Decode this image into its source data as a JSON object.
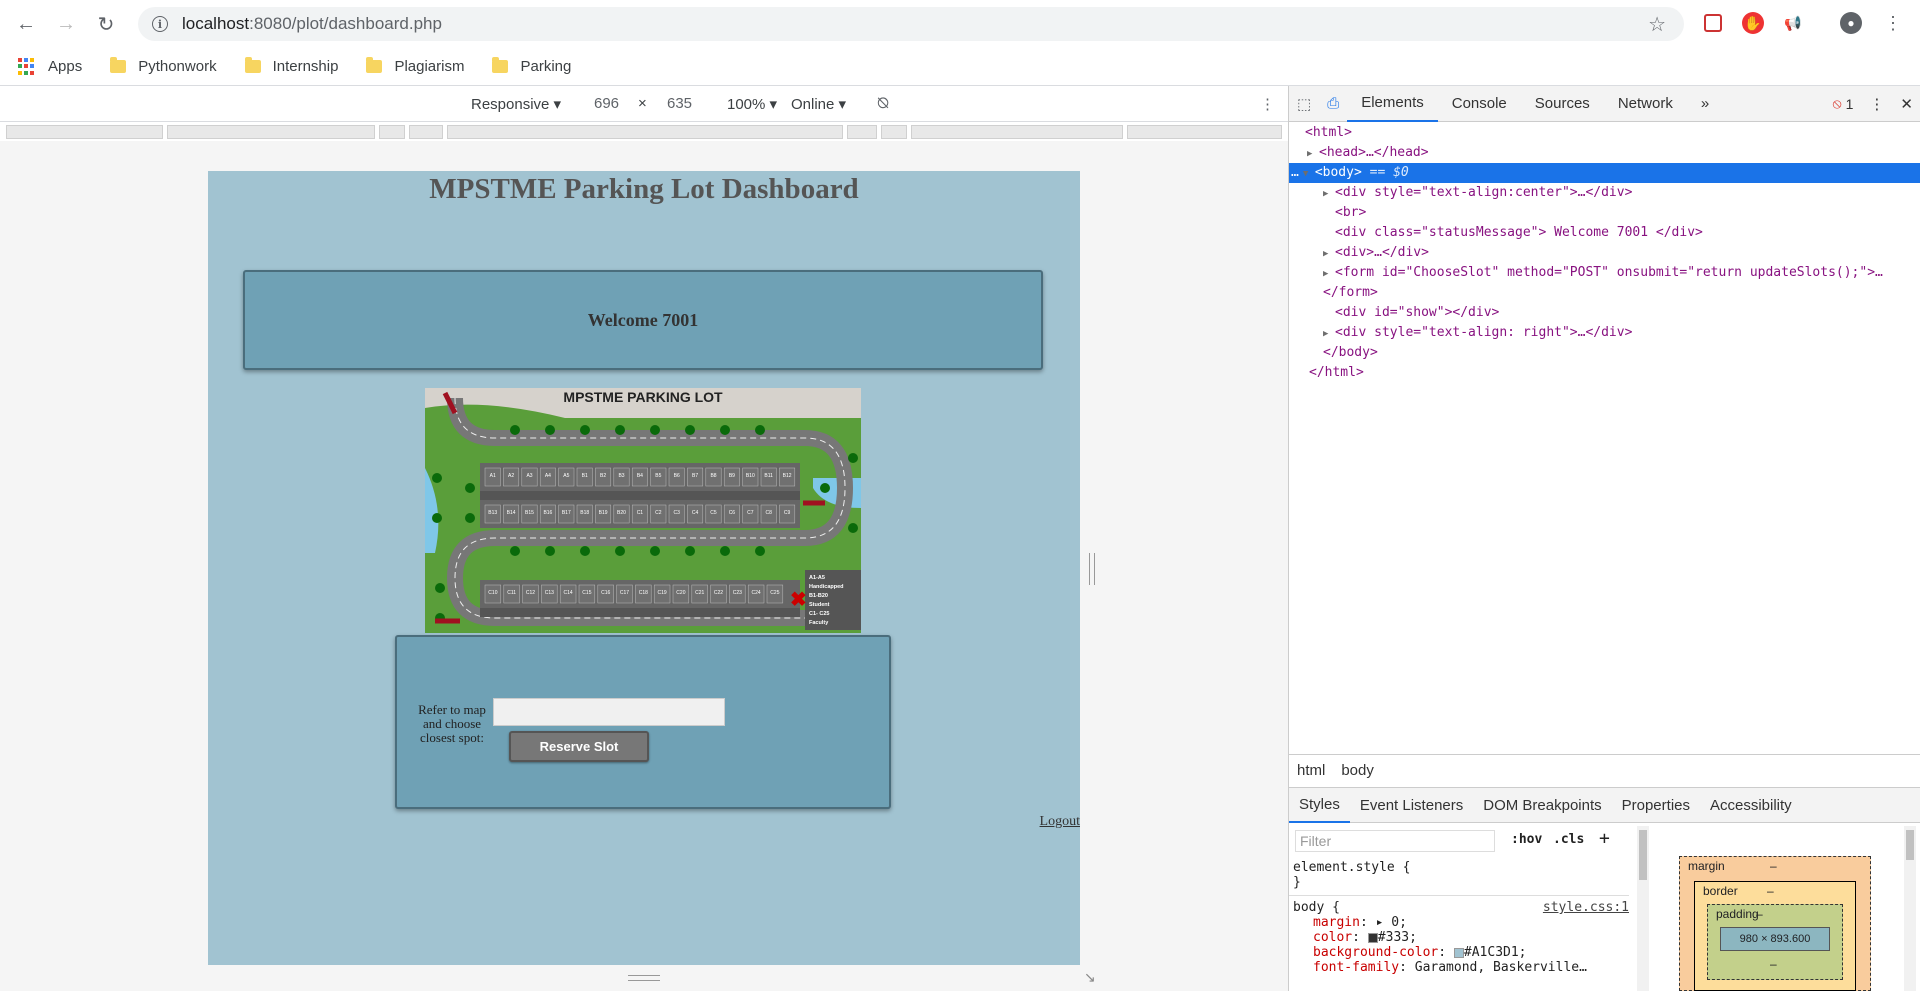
{
  "browser": {
    "url_host": "localhost",
    "url_port_path": ":8080/plot/dashboard.php",
    "bookmarks": [
      "Apps",
      "Pythonwork",
      "Internship",
      "Plagiarism",
      "Parking"
    ]
  },
  "device_toolbar": {
    "device": "Responsive",
    "width": "696",
    "times": "×",
    "height": "635",
    "zoom": "100%",
    "network": "Online"
  },
  "page": {
    "title": "MPSTME Parking Lot Dashboard",
    "welcome": "Welcome 7001",
    "map_title": "MPSTME PARKING LOT",
    "map_legend": [
      "A1-A5",
      "Handicapped",
      "B1-B20",
      "Student",
      "C1- C25",
      "Faculty"
    ],
    "row1": [
      "A1",
      "A2",
      "A3",
      "A4",
      "A5",
      "B1",
      "B2",
      "B3",
      "B4",
      "B5",
      "B6",
      "B7",
      "B8",
      "B9",
      "B10",
      "B11",
      "B12"
    ],
    "row2": [
      "B13",
      "B14",
      "B15",
      "B16",
      "B17",
      "B18",
      "B19",
      "B20",
      "C1",
      "C2",
      "C3",
      "C4",
      "C5",
      "C6",
      "C7",
      "C8",
      "C9"
    ],
    "row3": [
      "C10",
      "C11",
      "C12",
      "C13",
      "C14",
      "C15",
      "C16",
      "C17",
      "C18",
      "C19",
      "C20",
      "C21",
      "C22",
      "C23",
      "C24",
      "C25"
    ],
    "refer_text": "Refer to map and choose closest spot:",
    "reserve_button": "Reserve Slot",
    "logout": "Logout"
  },
  "devtools": {
    "tabs": [
      "Elements",
      "Console",
      "Sources",
      "Network"
    ],
    "more_tabs": "»",
    "error_count": "1",
    "dom": {
      "html_open": "<html>",
      "head": "<head>…</head>",
      "body_open": "<body>",
      "body_marker": "== $0",
      "div_center": "<div style=\"text-align:center\">…</div>",
      "br": "<br>",
      "status_div": "<div class=\"statusMessage\"> Welcome 7001 </div>",
      "div_collapsed": "<div>…</div>",
      "form": "<form id=\"ChooseSlot\" method=\"POST\" onsubmit=\"return updateSlots();\">…",
      "form_close": "</form>",
      "div_show": "<div id=\"show\"></div>",
      "div_right": "<div style=\"text-align: right\">…</div>",
      "body_close": "</body>",
      "html_close": "</html>"
    },
    "crumbs": [
      "html",
      "body"
    ],
    "style_tabs": [
      "Styles",
      "Event Listeners",
      "DOM Breakpoints",
      "Properties",
      "Accessibility"
    ],
    "filter_placeholder": "Filter",
    "hov": ":hov",
    "cls": ".cls",
    "plus": "+",
    "element_style": "element.style {",
    "close_brace": "}",
    "body_rule": "body {",
    "rule_source": "style.css:1",
    "props": [
      {
        "name": "margin",
        "value": "▸ 0;"
      },
      {
        "name": "color",
        "value": "#333;"
      },
      {
        "name": "background-color",
        "value": "#A1C3D1;"
      },
      {
        "name": "font-family",
        "value": "Garamond, Baskerville…"
      }
    ],
    "boxmodel": {
      "margin": "margin",
      "border": "border",
      "padding": "padding",
      "dash": "–",
      "content": "980 × 893.600"
    }
  }
}
